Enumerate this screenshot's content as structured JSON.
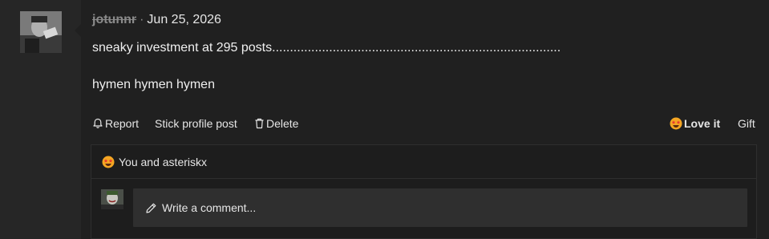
{
  "post": {
    "username": "jotunnr",
    "separator": "·",
    "date": "Jun 25, 2026",
    "lines": [
      "sneaky investment at 295 posts.................................................................................",
      "hymen hymen hymen"
    ]
  },
  "actions": {
    "report_label": "Report",
    "stick_label": "Stick profile post",
    "delete_label": "Delete",
    "love_label": "Love it",
    "gift_label": "Gift"
  },
  "reactions": {
    "summary": "You and asteriskx",
    "icon": "star-struck-emoji"
  },
  "comment": {
    "placeholder": "Write a comment..."
  },
  "colors": {
    "background": "#202020",
    "gutter": "#262626",
    "muted_text": "#8a8a8a",
    "text": "#e6e6e6",
    "input_bg": "#2f2f2f",
    "emoji_face": "#f5a623",
    "emoji_star": "#e8392f"
  }
}
